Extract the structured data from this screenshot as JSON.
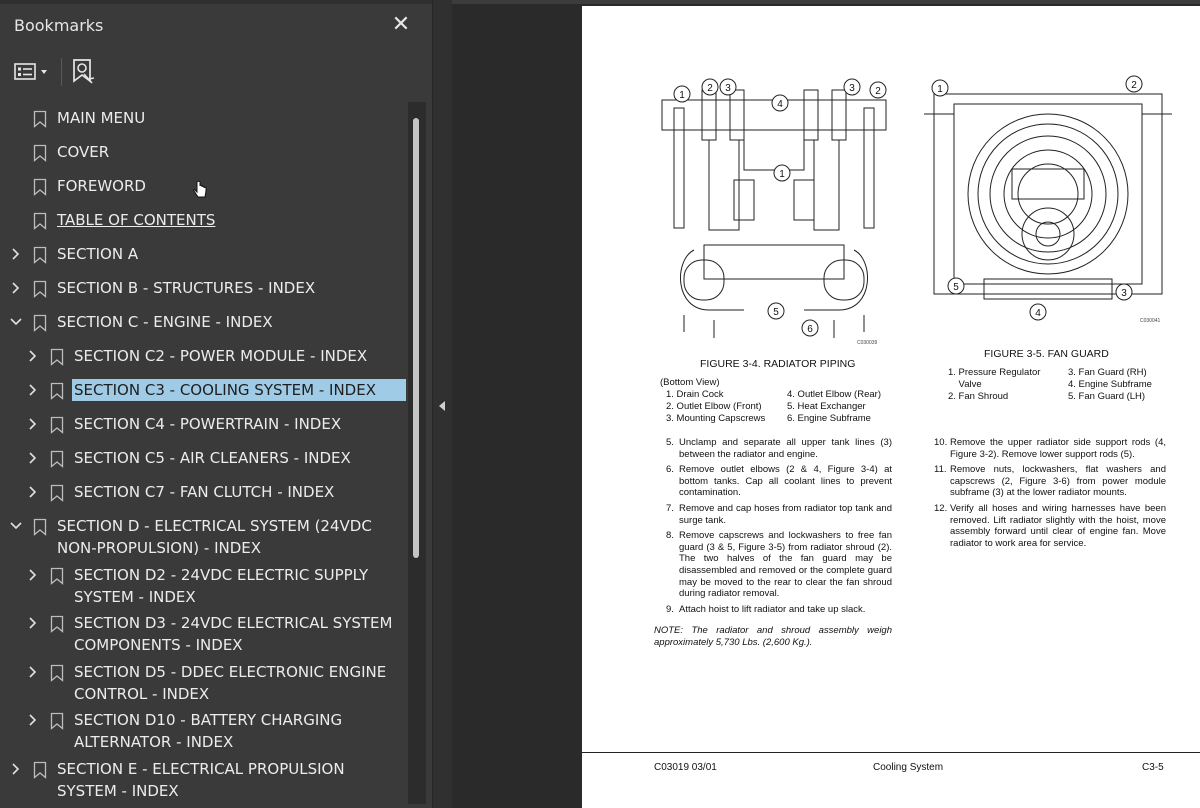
{
  "panel": {
    "title": "Bookmarks",
    "close_glyph": "✕",
    "options_icon": "bookmark-options-icon",
    "new_bookmark_icon": "new-bookmark-icon"
  },
  "bookmarks": [
    {
      "label": "MAIN MENU",
      "level": 0,
      "expander": "none"
    },
    {
      "label": "COVER",
      "level": 0,
      "expander": "none"
    },
    {
      "label": "FOREWORD",
      "level": 0,
      "expander": "none"
    },
    {
      "label": "TABLE OF CONTENTS",
      "level": 0,
      "expander": "none",
      "underlined": true
    },
    {
      "label": "SECTION A",
      "level": 0,
      "expander": "collapsed"
    },
    {
      "label": "SECTION B - STRUCTURES - INDEX",
      "level": 0,
      "expander": "collapsed"
    },
    {
      "label": "SECTION C - ENGINE - INDEX",
      "level": 0,
      "expander": "expanded"
    },
    {
      "label": "SECTION C2 - POWER MODULE - INDEX",
      "level": 1,
      "expander": "collapsed"
    },
    {
      "label": "SECTION C3 - COOLING SYSTEM - INDEX",
      "level": 1,
      "expander": "collapsed",
      "selected": true
    },
    {
      "label": "SECTION C4 - POWERTRAIN - INDEX",
      "level": 1,
      "expander": "collapsed"
    },
    {
      "label": "SECTION C5 - AIR  CLEANERS - INDEX",
      "level": 1,
      "expander": "collapsed"
    },
    {
      "label": "SECTION C7 - FAN CLUTCH - INDEX",
      "level": 1,
      "expander": "collapsed"
    },
    {
      "label": "SECTION D - ELECTRICAL SYSTEM (24VDC NON-PROPULSION) - INDEX",
      "level": 0,
      "expander": "expanded"
    },
    {
      "label": "SECTION D2 - 24VDC ELECTRIC SUPPLY SYSTEM - INDEX",
      "level": 1,
      "expander": "collapsed"
    },
    {
      "label": "SECTION D3 - 24VDC ELECTRICAL SYSTEM COMPONENTS - INDEX",
      "level": 1,
      "expander": "collapsed"
    },
    {
      "label": "SECTION D5 - DDEC ELECTRONIC ENGINE CONTROL - INDEX",
      "level": 1,
      "expander": "collapsed"
    },
    {
      "label": "SECTION D10 - BATTERY CHARGING ALTERNATOR - INDEX",
      "level": 1,
      "expander": "collapsed"
    },
    {
      "label": "SECTION E - ELECTRICAL PROPULSION SYSTEM - INDEX",
      "level": 0,
      "expander": "collapsed"
    }
  ],
  "document": {
    "fig4": {
      "caption": "FIGURE 3-4. RADIATOR PIPING",
      "view": "(Bottom View)",
      "legend_left": [
        "1. Drain Cock",
        "2. Outlet Elbow (Front)",
        "3. Mounting Capscrews"
      ],
      "legend_right": [
        "4. Outlet Elbow (Rear)",
        "5. Heat Exchanger",
        "6. Engine Subframe"
      ],
      "code": "C030039"
    },
    "fig5": {
      "caption": "FIGURE 3-5. FAN GUARD",
      "legend_left": [
        "1. Pressure Regulator",
        "    Valve",
        "2. Fan Shroud"
      ],
      "legend_right": [
        "3. Fan Guard (RH)",
        "4. Engine Subframe",
        "5. Fan Guard (LH)"
      ],
      "code": "C030041"
    },
    "steps_left": [
      {
        "num": "5.",
        "text": "Unclamp and separate all upper tank lines (3) between the radiator and engine."
      },
      {
        "num": "6.",
        "text": "Remove outlet elbows (2 & 4, Figure 3-4) at bottom tanks. Cap all coolant lines to prevent contamination."
      },
      {
        "num": "7.",
        "text": "Remove and cap hoses from radiator top tank and surge tank."
      },
      {
        "num": "8.",
        "text": "Remove capscrews and lockwashers to free fan guard (3 & 5, Figure 3-5) from radiator shroud (2). The two halves of the fan guard may be disassembled and removed or the complete guard may be moved to the rear to clear the fan shroud during radiator removal."
      },
      {
        "num": "9.",
        "text": "Attach hoist to lift radiator and take up slack."
      }
    ],
    "note": "NOTE: The radiator and shroud assembly weigh approximately 5,730 Lbs. (2,600 Kg.).",
    "steps_right": [
      {
        "num": "10.",
        "text": "Remove the upper radiator side support rods (4, Figure 3-2). Remove lower support rods (5)."
      },
      {
        "num": "11.",
        "text": "Remove nuts, lockwashers, flat washers and capscrews (2, Figure 3-6) from power module subframe (3) at the lower radiator mounts."
      },
      {
        "num": "12.",
        "text": "Verify all hoses and wiring harnesses have been removed. Lift radiator slightly with the hoist, move assembly forward until clear of engine fan. Move radiator to work area for service."
      }
    ],
    "footer": {
      "left": "C03019  03/01",
      "center": "Cooling System",
      "right": "C3-5"
    }
  }
}
